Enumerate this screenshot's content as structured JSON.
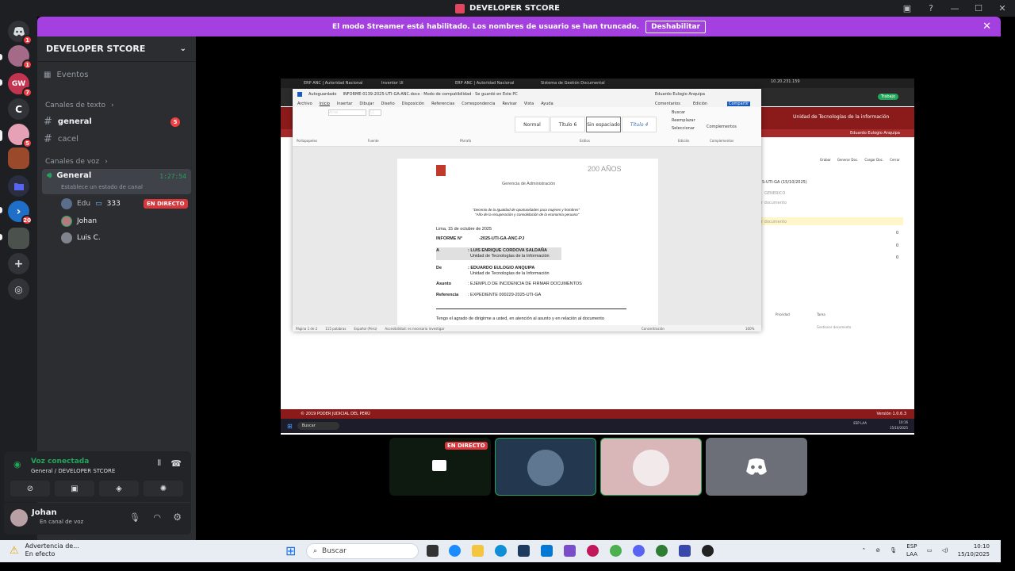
{
  "titlebar": {
    "title": "DEVELOPER STCORE"
  },
  "banner": {
    "message": "El modo Streamer está habilitado. Los nombres de usuario se han truncado.",
    "button": "Deshabilitar"
  },
  "rail": {
    "servers": [
      {
        "icon": "discord-icon",
        "badge": "1"
      },
      {
        "icon": "avatar",
        "badge": "1"
      },
      {
        "icon": "server-gw",
        "badge": "7"
      },
      {
        "letter": "C"
      },
      {
        "icon": "server-pink",
        "badge": "5"
      },
      {
        "icon": "server-photo"
      },
      {
        "icon": "folder-icon"
      },
      {
        "icon": "server-blue",
        "badge": "20"
      },
      {
        "icon": "server-dark"
      }
    ]
  },
  "sidebar": {
    "server_name": "DEVELOPER STCORE",
    "events": "Eventos",
    "text_category": "Canales de texto",
    "channels": [
      {
        "name": "general",
        "badge": "5"
      },
      {
        "name": "cacel"
      }
    ],
    "voice_category": "Canales de voz",
    "voice_channel": {
      "name": "General",
      "timer": "1:27:54",
      "status": "Establece un estado de canal"
    },
    "voice_users": [
      {
        "name": "Edu",
        "extra": "333",
        "live": "EN DIRECTO"
      },
      {
        "name": "Johan"
      },
      {
        "name": "Luis C."
      }
    ]
  },
  "voice_panel": {
    "status": "Voz conectada",
    "channel": "General / DEVELOPER STCORE"
  },
  "user_panel": {
    "name": "Johan",
    "status": "En canal de voz"
  },
  "stream": {
    "remote_ip": "10.20.231.159",
    "remote_tabs": [
      "ERP ANC | Autoridad Nacional",
      "Inventor UI",
      "ERP ANC | Autoridad Nacional",
      "Sistema de Gestión Documental"
    ],
    "portal_title": "Unidad de Tecnologías de la información",
    "portal_user": "Eduardo Eulogio Anquipa",
    "portal_doc": "S-UTI-GA (15/10/2025)",
    "portal_actions": [
      "Grabar",
      "Generar Doc.",
      "Cargar Doc.",
      "Cerrar"
    ],
    "portal_fields": [
      "GENERICO",
      "r documento",
      "r documento"
    ],
    "portal_counts": [
      "0",
      "0",
      "0"
    ],
    "portal_cols": [
      "Prioridad",
      "Tarea"
    ],
    "portal_task": "Gestionar documento",
    "footer_left": "© 2019 PODER JUDICIAL DEL PERÚ",
    "footer_right": "Versión 1.0.6.3",
    "remote_search": "Buscar",
    "remote_lang": "ESP LAA",
    "remote_clock": "10:16",
    "remote_date": "15/10/2025",
    "word": {
      "file_title": "INFORME-0139-2025-UTI-GA-ANC.docx  ·  Modo de compatibilidad  ·  Se guardó en Este PC",
      "user": "Eduardo Eulogio Anquipa",
      "autosave": "Autoguardado",
      "menu": [
        "Archivo",
        "Inicio",
        "Insertar",
        "Dibujar",
        "Diseño",
        "Disposición",
        "Referencias",
        "Correspondencia",
        "Revisar",
        "Vista",
        "Ayuda"
      ],
      "right_buttons": [
        "Comentarios",
        "Edición",
        "Compartir"
      ],
      "font": "Arial",
      "font_size": "11",
      "styles": [
        "Normal",
        "Título 6",
        "Sin espaciado",
        "Título 4"
      ],
      "groups": [
        "Portapapeles",
        "Fuente",
        "Párrafo",
        "Estilos",
        "Edición",
        "Complementos"
      ],
      "edit_items": [
        "Buscar",
        "Reemplazar",
        "Seleccionar"
      ],
      "complementos": "Complementos",
      "status": [
        "Página 1 de 2",
        "115 palabras",
        "Español (Perú)",
        "Accesibilidad: es necesario investigar",
        "Concentración",
        "100%"
      ],
      "doc": {
        "org": "Gerencia de Administración",
        "anos": "200 AÑOS",
        "decenio": "\"Decenio de la Igualdad de oportunidades para mujeres y hombres\"",
        "anio": "\"Año de la recuperación y consolidación de la economía peruana\"",
        "fecha": "Lima, 15 de octubre de 2025",
        "informe_label": "INFORME N°",
        "informe_num": "-2025-UTI-GA-ANC-PJ",
        "a_label": "A",
        "a_name": ": LUIS ENRIQUE CORDOVA SALDAÑA",
        "a_unit": "Unidad de Tecnologías de la Información",
        "de_label": "De",
        "de_name": ": EDUARDO EULOGIO ANQUIPA",
        "de_unit": "Unidad de Tecnologías de la Información",
        "asunto_label": "Asunto",
        "asunto": ": EJEMPLO DE INCIDENCIA DE FIRMAR DOCUMENTOS",
        "ref_label": "Referencia",
        "ref": ": EXPEDIENTE 000229-2025-UTI-GA",
        "body": "Tengo el agrado de dirigirme a usted, en atención al asunto y en relación al documento"
      }
    }
  },
  "tiles": [
    {
      "name": "Edu",
      "live": "EN DIRECTO"
    },
    {
      "name": "tile-2"
    },
    {
      "name": "Johan"
    },
    {
      "name": "Luis C."
    }
  ],
  "taskbar": {
    "warning_title": "Advertencia de...",
    "warning_sub": "En efecto",
    "search": "Buscar",
    "lang": "ESP",
    "lang2": "LAA",
    "time": "10:10",
    "date": "15/10/2025"
  }
}
